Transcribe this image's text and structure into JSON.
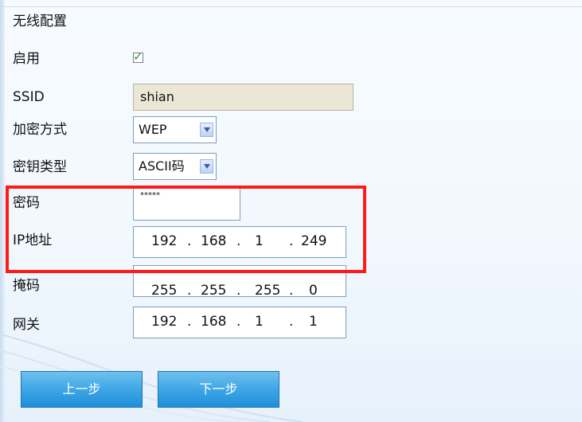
{
  "title": "无线配置",
  "fields": {
    "enable_label": "启用",
    "enable_checked": true,
    "ssid_label": "SSID",
    "ssid_value": "shian",
    "encryption_label": "加密方式",
    "encryption_value": "WEP",
    "key_type_label": "密钥类型",
    "key_type_value": "ASCII码",
    "password_label": "密码",
    "password_value": "*****",
    "ip_label": "IP地址",
    "ip_octets": [
      "192",
      "168",
      "1",
      "249"
    ],
    "mask_label": "掩码",
    "mask_octets": [
      "255",
      "255",
      "255",
      "0"
    ],
    "gateway_label": "网关",
    "gateway_octets": [
      "192",
      "168",
      "1",
      "1"
    ]
  },
  "buttons": {
    "prev": "上一步",
    "next": "下一步"
  },
  "colors": {
    "highlight": "#ff1a1a",
    "button": "#3fa6e6",
    "ssid_bg": "#ece6d5"
  }
}
